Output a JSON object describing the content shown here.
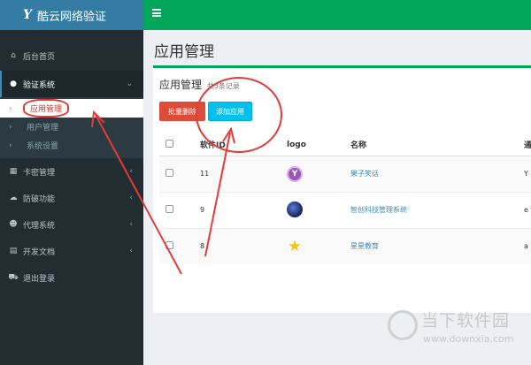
{
  "app": {
    "logo_mark": "Y",
    "logo_text": "酷云网络验证"
  },
  "sidebar": {
    "items": [
      {
        "label": "后台首页",
        "icon": "home-icon"
      },
      {
        "label": "验证系统",
        "icon": "circle-icon"
      },
      {
        "label": "卡密管理",
        "icon": "table-icon"
      },
      {
        "label": "防破功能",
        "icon": "cloud-icon"
      },
      {
        "label": "代理系统",
        "icon": "users-icon"
      },
      {
        "label": "开发文档",
        "icon": "book-icon"
      },
      {
        "label": "退出登录",
        "icon": "car-icon"
      }
    ],
    "submenu": [
      "应用管理",
      "用户管理",
      "系统设置"
    ]
  },
  "page": {
    "title": "应用管理"
  },
  "box": {
    "title": "应用管理",
    "subtitle": "共3条记录",
    "delete_button": "批量删除",
    "add_button": "添加应用"
  },
  "table": {
    "headers": [
      "",
      "软件ID",
      "logo",
      "名称",
      "通"
    ],
    "rows": [
      {
        "id": "11",
        "logo": "letter-y-logo",
        "name": "果子笑话",
        "extra": "Y"
      },
      {
        "id": "9",
        "logo": "space-logo",
        "name": "智创科技管理系统",
        "extra": "e"
      },
      {
        "id": "8",
        "logo": "star-logo",
        "name": "星星教育",
        "extra": "a"
      }
    ]
  },
  "watermark": {
    "brand": "当下软件园",
    "url": "www.downxia.com"
  },
  "colors": {
    "topbar": "#00a65a",
    "sidebar": "#222d32",
    "delete": "#dd4b39",
    "add": "#00c0ef",
    "annotation": "#e23b3b"
  }
}
